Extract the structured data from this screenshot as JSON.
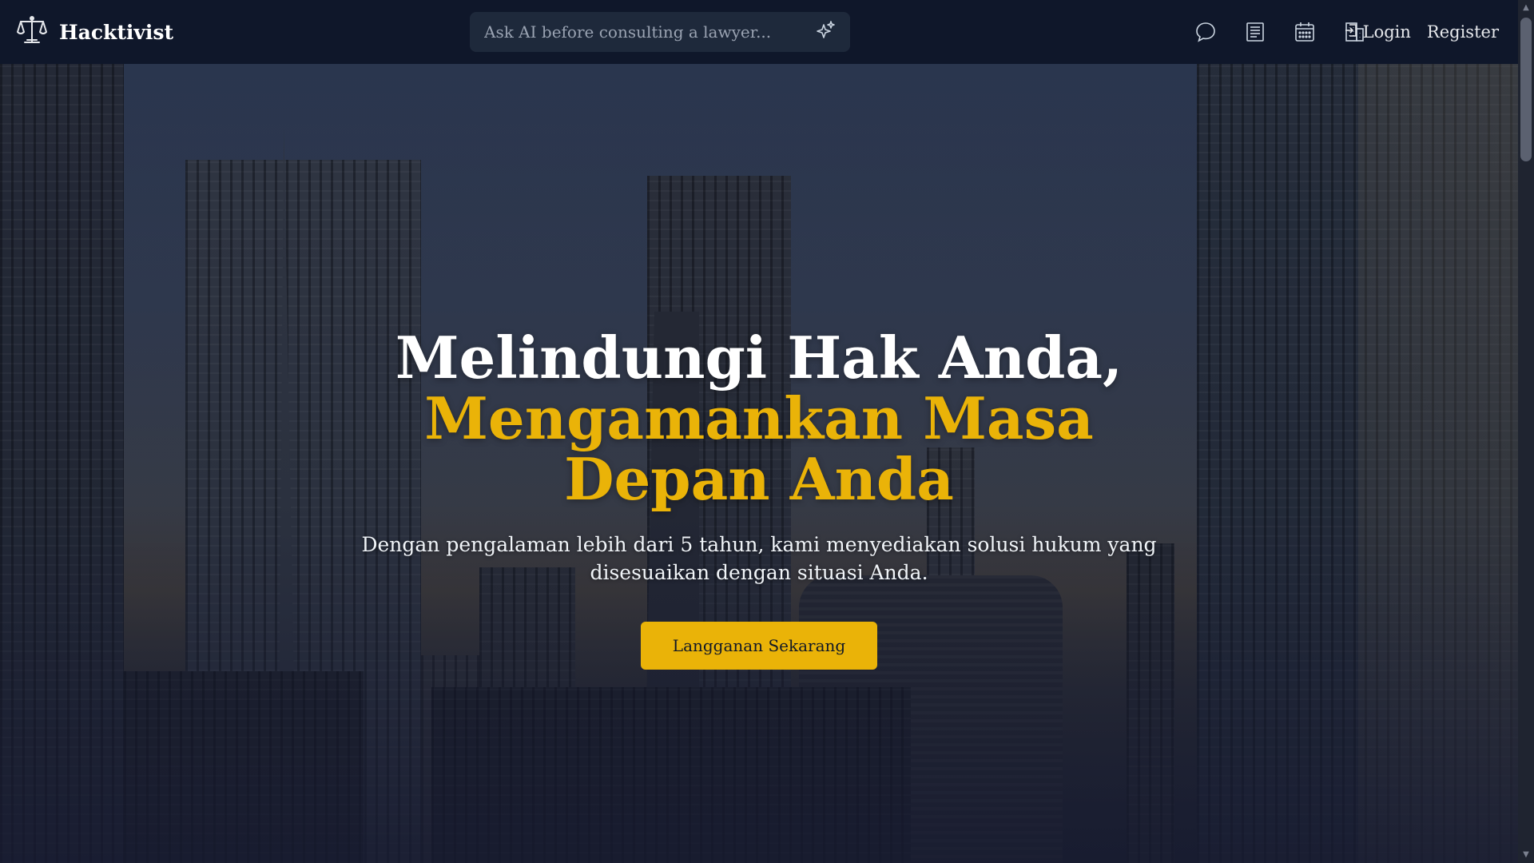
{
  "navbar": {
    "brand": "Hacktivist",
    "search_placeholder": "Ask AI before consulting a lawyer...",
    "icons": [
      "chat-icon",
      "document-icon",
      "calendar-icon",
      "building-icon"
    ],
    "login": "Login",
    "register": "Register"
  },
  "hero": {
    "title_line1": "Melindungi Hak Anda,",
    "title_line2": "Mengamankan Masa",
    "title_line3": "Depan Anda",
    "subtitle": "Dengan pengalaman lebih dari 5 tahun, kami menyediakan solusi hukum yang disesuaikan dengan situasi Anda.",
    "cta": "Langganan Sekarang"
  },
  "colors": {
    "nav_bg": "#0f172a",
    "accent": "#eab308",
    "search_bg": "#1e293b"
  }
}
